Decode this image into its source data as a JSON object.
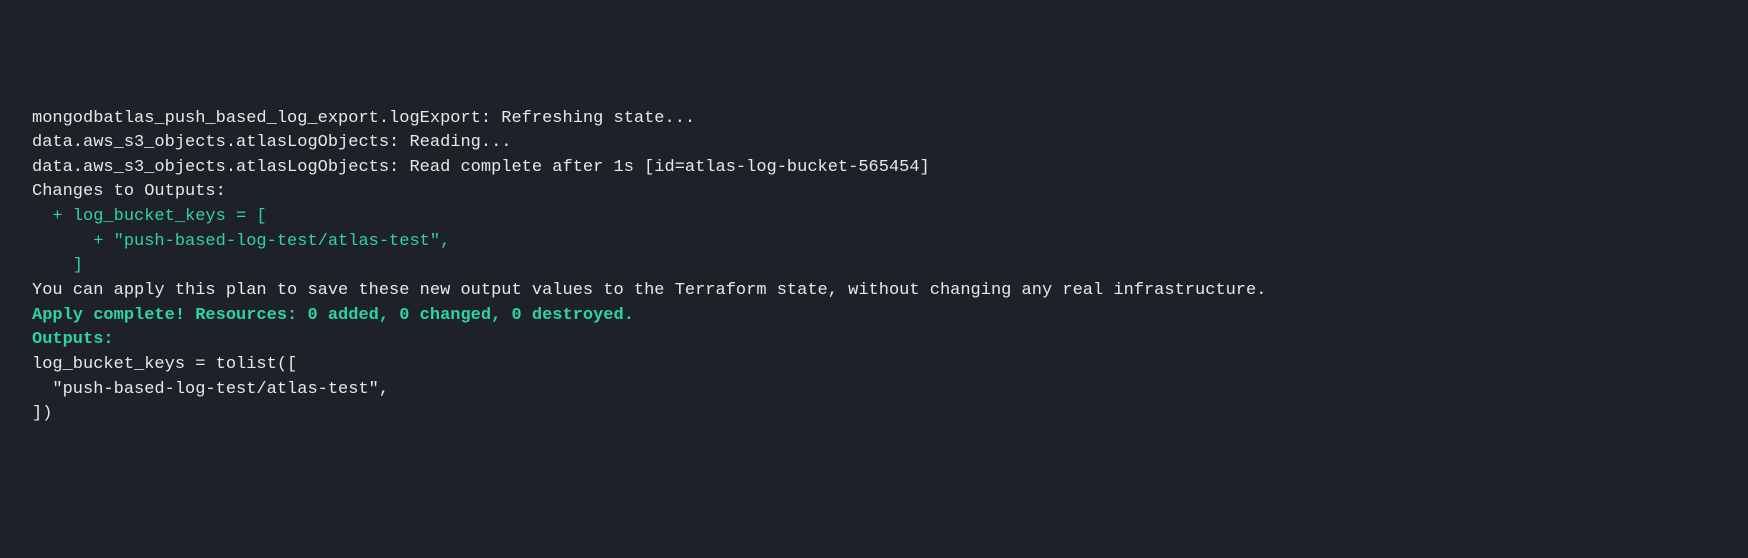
{
  "terminal": {
    "line1": "mongodbatlas_push_based_log_export.logExport: Refreshing state...",
    "line2": "data.aws_s3_objects.atlasLogObjects: Reading...",
    "line3": "data.aws_s3_objects.atlasLogObjects: Read complete after 1s [id=atlas-log-bucket-565454]",
    "blank1": "",
    "changes_header": "Changes to Outputs:",
    "changes_line1": "  + log_bucket_keys = [",
    "changes_line2": "      + \"push-based-log-test/atlas-test\",",
    "changes_line3": "    ]",
    "blank2": "",
    "apply_hint": "You can apply this plan to save these new output values to the Terraform state, without changing any real infrastructure.",
    "blank3": "",
    "apply_complete": "Apply complete! Resources: 0 added, 0 changed, 0 destroyed.",
    "blank4": "",
    "outputs_header": "Outputs:",
    "blank5": "",
    "output_line1": "log_bucket_keys = tolist([",
    "output_line2": "  \"push-based-log-test/atlas-test\",",
    "output_line3": "])"
  }
}
